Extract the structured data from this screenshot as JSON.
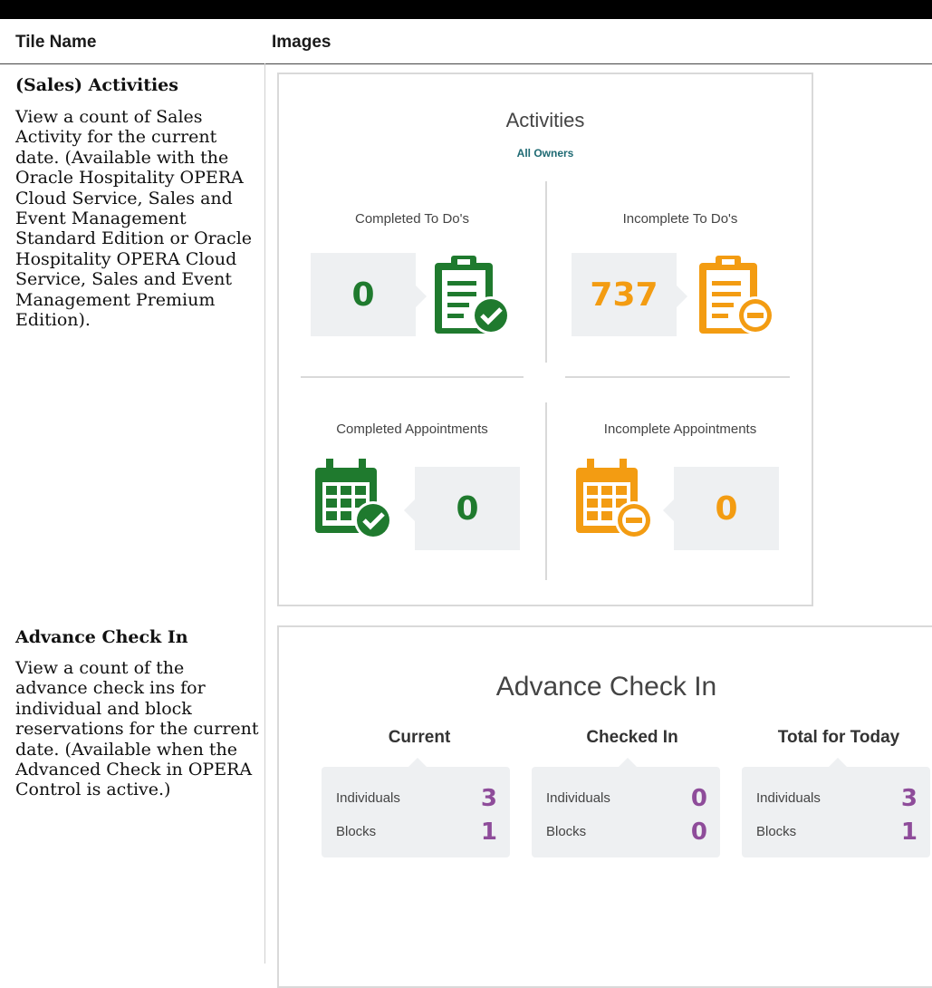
{
  "table": {
    "headers": [
      "Tile Name",
      "Images"
    ]
  },
  "rows": [
    {
      "title": "(Sales) Activities",
      "description": "View a count of Sales Activity for the current date. (Available with the Oracle Hospitality OPERA Cloud Service, Sales and Event Management Standard Edition or Oracle Hospitality OPERA Cloud Service, Sales and Event Management Premium Edition)."
    },
    {
      "title": "Advance Check In",
      "description": "View a count of the advance check ins for individual and block reservations for the current date. (Available when the Advanced Check in OPERA Control is active.)"
    }
  ],
  "activities_tile": {
    "title": "Activities",
    "subtitle": "All Owners",
    "quadrants": [
      {
        "label": "Completed To Do's",
        "value": "0",
        "icon": "clipboard-check-icon",
        "color": "#1f7a2e"
      },
      {
        "label": "Incomplete To Do's",
        "value": "737",
        "icon": "clipboard-minus-icon",
        "color": "#f39c12"
      },
      {
        "label": "Completed Appointments",
        "value": "0",
        "icon": "calendar-check-icon",
        "color": "#1f7a2e"
      },
      {
        "label": "Incomplete Appointments",
        "value": "0",
        "icon": "calendar-minus-icon",
        "color": "#f39c12"
      }
    ]
  },
  "advance_checkin_tile": {
    "title": "Advance Check In",
    "columns": [
      {
        "heading": "Current",
        "individuals_label": "Individuals",
        "individuals": "3",
        "blocks_label": "Blocks",
        "blocks": "1"
      },
      {
        "heading": "Checked In",
        "individuals_label": "Individuals",
        "individuals": "0",
        "blocks_label": "Blocks",
        "blocks": "0"
      },
      {
        "heading": "Total for Today",
        "individuals_label": "Individuals",
        "individuals": "3",
        "blocks_label": "Blocks",
        "blocks": "1"
      }
    ],
    "value_color": "#8e4c9a"
  }
}
